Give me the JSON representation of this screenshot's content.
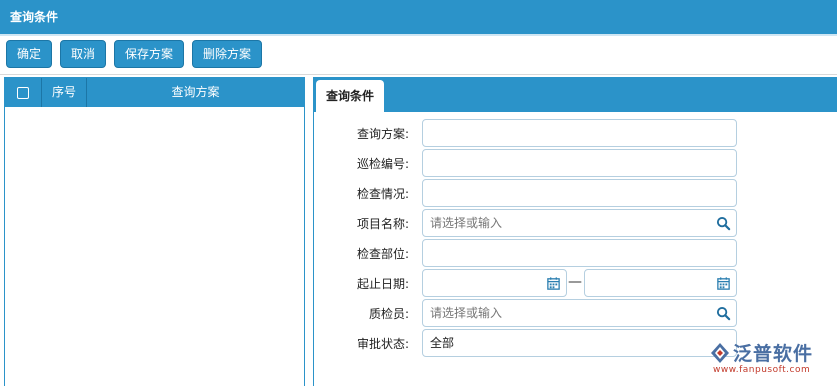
{
  "window": {
    "title": "查询条件"
  },
  "toolbar": {
    "confirm_label": "确定",
    "cancel_label": "取消",
    "save_scheme_label": "保存方案",
    "delete_scheme_label": "删除方案"
  },
  "scheme_list": {
    "columns": {
      "seq": "序号",
      "name": "查询方案"
    },
    "rows": []
  },
  "query_tab": {
    "label": "查询条件"
  },
  "form": {
    "query_scheme": {
      "label": "查询方案:",
      "value": ""
    },
    "inspection_no": {
      "label": "巡检编号:",
      "value": ""
    },
    "check_status": {
      "label": "检查情况:",
      "value": ""
    },
    "project_name": {
      "label": "项目名称:",
      "placeholder": "请选择或输入"
    },
    "check_part": {
      "label": "检查部位:",
      "value": ""
    },
    "date_range": {
      "label": "起止日期:",
      "separator": "—",
      "start": "",
      "end": ""
    },
    "inspector": {
      "label": "质检员:",
      "placeholder": "请选择或输入"
    },
    "approval_status": {
      "label": "审批状态:",
      "value": "全部"
    }
  },
  "watermark": {
    "brand": "泛普软件",
    "url": "www.fanpusoft.com"
  },
  "colors": {
    "primary": "#2b93c9",
    "field_border": "#b5cfe0",
    "brand_blue": "#4a6fa3",
    "brand_red": "#c23a2b"
  },
  "icons": {
    "search": "magnifier-icon",
    "calendar": "calendar-icon",
    "logo": "fanpu-logo-icon"
  }
}
